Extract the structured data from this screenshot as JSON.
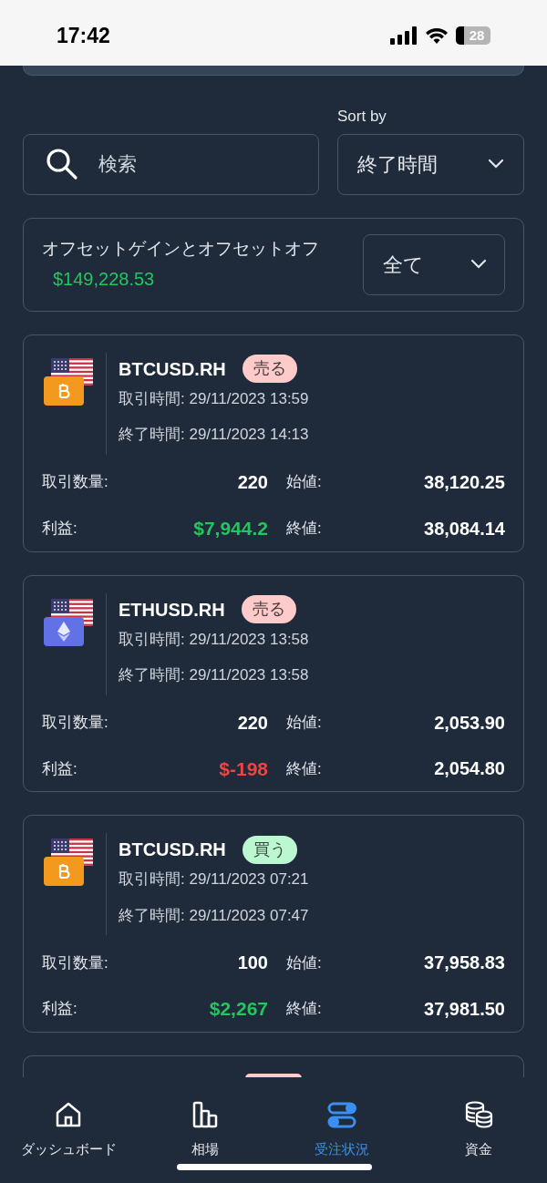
{
  "status_bar": {
    "time": "17:42",
    "battery": "28"
  },
  "sort": {
    "label": "Sort by",
    "value": "終了時間"
  },
  "search": {
    "placeholder": "検索"
  },
  "summary": {
    "label": "オフセットゲインとオフセットオフ",
    "amount": "$149,228.53",
    "filter": "全て"
  },
  "trades": [
    {
      "kind": "btc",
      "symbol": "BTCUSD.RH",
      "side": {
        "label": "売る",
        "color": "#fecaca"
      },
      "open_time": "取引時間: 29/11/2023 13:59",
      "close_time": "終了時間: 29/11/2023 14:13",
      "qty_label": "取引数量:",
      "qty": "220",
      "profit_label": "利益:",
      "profit": "$7,944.2",
      "profit_positive": true,
      "open_label": "始値:",
      "open_price": "38,120.25",
      "close_label": "終値:",
      "close_price": "38,084.14"
    },
    {
      "kind": "eth",
      "symbol": "ETHUSD.RH",
      "side": {
        "label": "売る",
        "color": "#fecaca"
      },
      "open_time": "取引時間: 29/11/2023 13:58",
      "close_time": "終了時間: 29/11/2023 13:58",
      "qty_label": "取引数量:",
      "qty": "220",
      "profit_label": "利益:",
      "profit": "$-198",
      "profit_positive": false,
      "open_label": "始値:",
      "open_price": "2,053.90",
      "close_label": "終値:",
      "close_price": "2,054.80"
    },
    {
      "kind": "btc",
      "symbol": "BTCUSD.RH",
      "side": {
        "label": "買う",
        "color": "#bbf7d0"
      },
      "open_time": "取引時間: 29/11/2023 07:21",
      "close_time": "終了時間: 29/11/2023 07:47",
      "qty_label": "取引数量:",
      "qty": "100",
      "profit_label": "利益:",
      "profit": "$2,267",
      "profit_positive": true,
      "open_label": "始値:",
      "open_price": "37,958.83",
      "close_label": "終値:",
      "close_price": "37,981.50"
    }
  ],
  "partial_trade": {
    "color": "#fecaca"
  },
  "nav": [
    {
      "kind": "home",
      "label": "ダッシュボード",
      "selected": false
    },
    {
      "kind": "chart",
      "label": "相場",
      "selected": false
    },
    {
      "kind": "toggles",
      "label": "受注状況",
      "selected": true
    },
    {
      "kind": "coins",
      "label": "資金",
      "selected": false
    }
  ]
}
